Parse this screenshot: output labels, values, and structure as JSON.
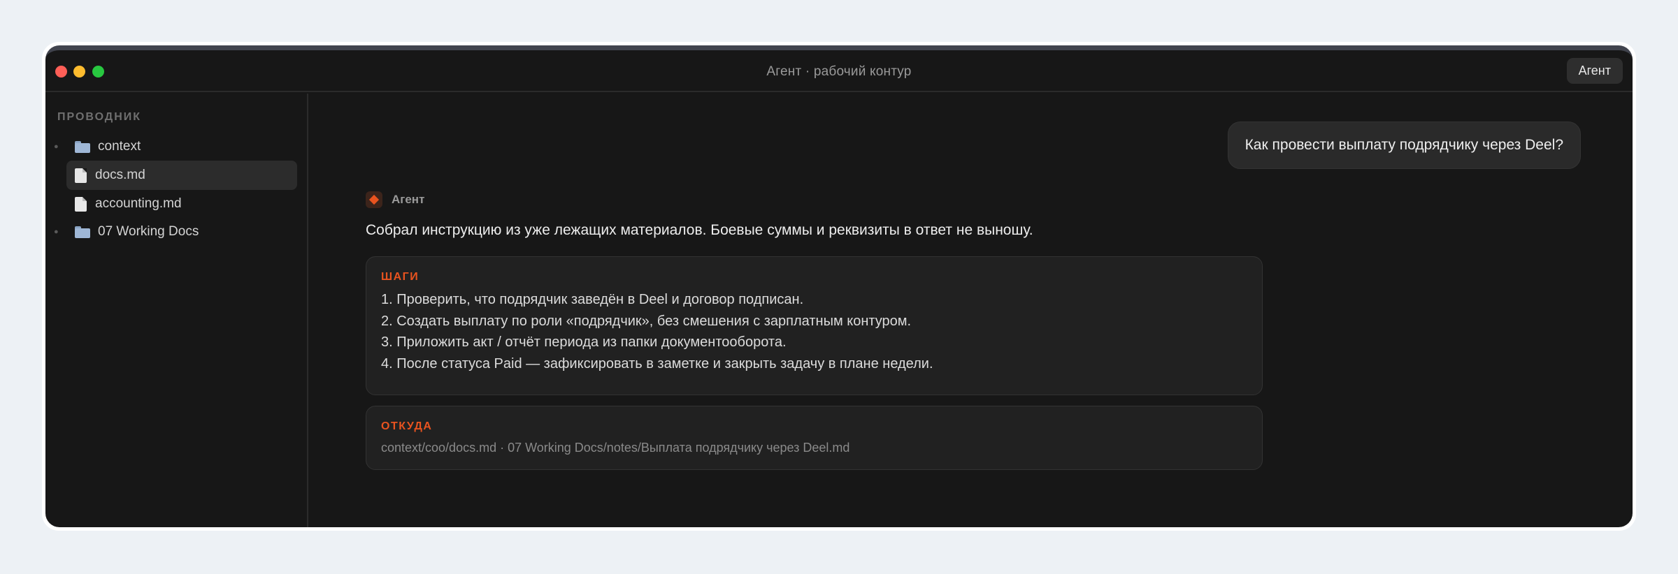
{
  "window": {
    "title": "Агент · рабочий контур",
    "agent_button": "Агент"
  },
  "sidebar": {
    "title": "ПРОВОДНИК",
    "items": [
      {
        "label": "context",
        "type": "folder",
        "icon": "folder-icon"
      },
      {
        "label": "docs.md",
        "type": "file",
        "icon": "file-icon",
        "selected": true
      },
      {
        "label": "accounting.md",
        "type": "file",
        "icon": "file-icon"
      },
      {
        "label": "07 Working Docs",
        "type": "folder",
        "icon": "folder-icon"
      }
    ]
  },
  "chat": {
    "user_message": "Как провести выплату подрядчику через Deel?",
    "agent_name": "Агент",
    "agent_intro": "Собрал инструкцию из уже лежащих материалов. Боевые суммы и реквизиты в ответ не выношу.",
    "steps_card": {
      "label": "ШАГИ",
      "steps": [
        "1. Проверить, что подрядчик заведён в Deel и договор подписан.",
        "2. Создать выплату по роли «подрядчик», без смешения с зарплатным контуром.",
        "3. Приложить акт / отчёт периода из папки документооборота.",
        "4. После статуса Paid — зафиксировать в заметке и закрыть задачу в плане недели."
      ]
    },
    "source_card": {
      "label": "ОТКУДА",
      "text": "context/coo/docs.md · 07 Working Docs/notes/Выплата подрядчику через Deel.md"
    }
  },
  "colors": {
    "accent": "#e8531f",
    "window_bg": "#171717",
    "card_bg": "#212121",
    "page_bg": "#edf1f5"
  }
}
